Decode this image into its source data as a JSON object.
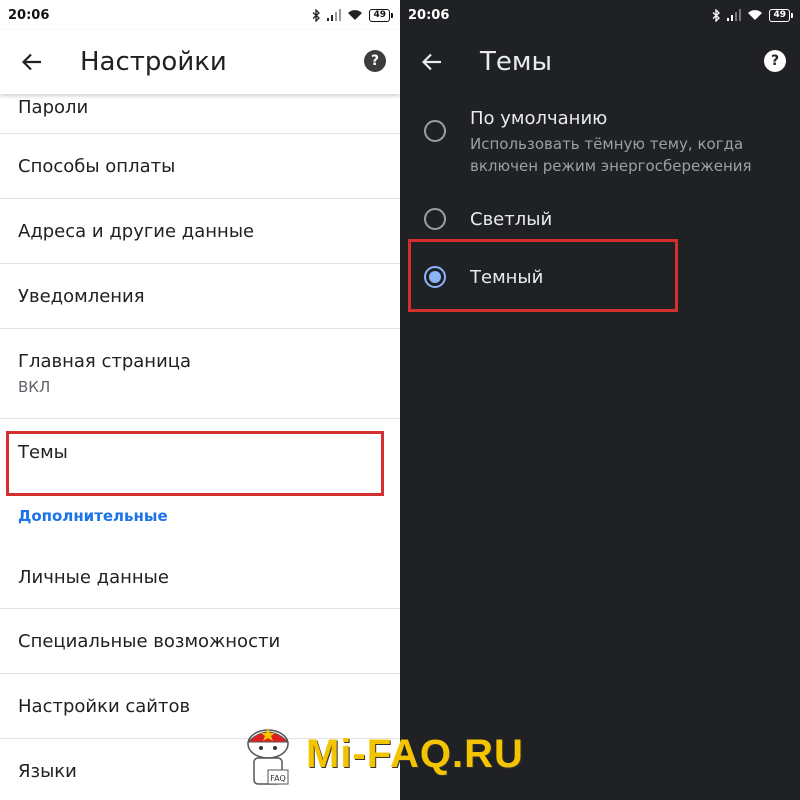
{
  "status": {
    "time": "20:06",
    "battery": "49"
  },
  "left": {
    "title": "Настройки",
    "items": [
      {
        "label": "Пароли"
      },
      {
        "label": "Способы оплаты"
      },
      {
        "label": "Адреса и другие данные"
      },
      {
        "label": "Уведомления"
      },
      {
        "label": "Главная страница",
        "sub": "ВКЛ"
      },
      {
        "label": "Темы"
      }
    ],
    "section_header": "Дополнительные",
    "items2": [
      {
        "label": "Личные данные"
      },
      {
        "label": "Специальные возможности"
      },
      {
        "label": "Настройки сайтов"
      },
      {
        "label": "Языки"
      }
    ]
  },
  "right": {
    "title": "Темы",
    "options": [
      {
        "label": "По умолчанию",
        "desc": "Использовать тёмную тему, когда включен режим энергосбережения",
        "selected": false
      },
      {
        "label": "Светлый",
        "selected": false
      },
      {
        "label": "Темный",
        "selected": true
      }
    ]
  },
  "watermark": {
    "brand": "Mi-FAQ.RU",
    "badge": "FAQ"
  },
  "colors": {
    "highlight": "#d32f2f",
    "accent_dark": "#8ab4f8",
    "section_blue": "#1a73e8",
    "brand_yellow": "#f5c400"
  }
}
